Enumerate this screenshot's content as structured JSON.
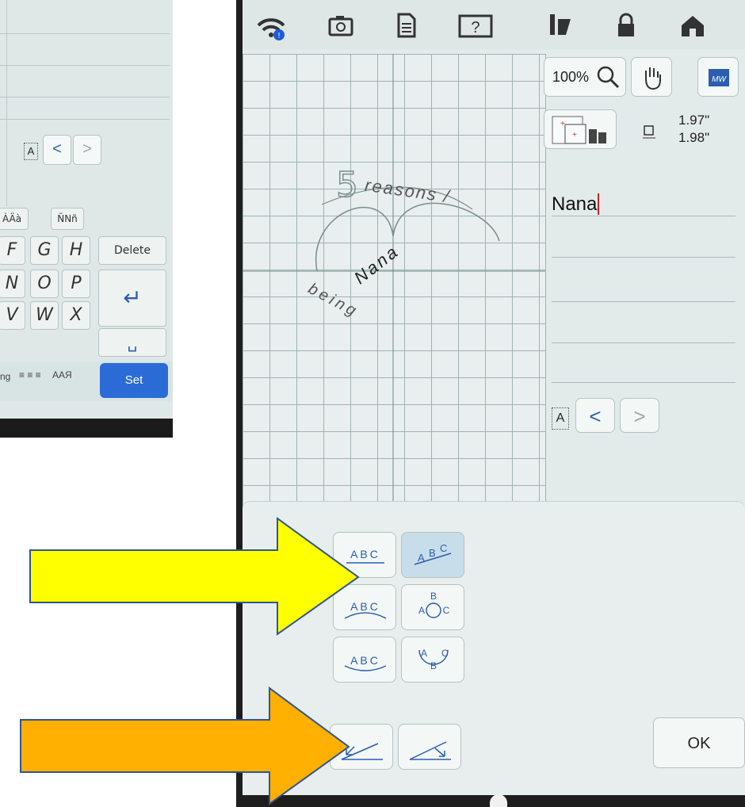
{
  "left_screen": {
    "nav_char": "A",
    "prev_label": "<",
    "next_label": ">",
    "accent_tabs": [
      "ÀÄà",
      "ÑNñ"
    ],
    "keys_row1": [
      "F",
      "G",
      "H"
    ],
    "keys_row2": [
      "N",
      "O",
      "P"
    ],
    "keys_row3": [
      "V",
      "W",
      "X"
    ],
    "delete_label": "Delete",
    "enter_icon": "↵",
    "space_icon": "␣",
    "bottom_partial": "ng",
    "align_icon": "≡ ≡ ≡",
    "font_icon": "AAЯ",
    "set_label": "Set"
  },
  "toolbar": {
    "icons": [
      "wifi-icon",
      "camera-icon",
      "document-icon",
      "help-icon",
      "needle-icon",
      "lock-icon",
      "home-icon"
    ]
  },
  "canvas": {
    "big_five": "5",
    "words": {
      "reasons": "reasons /",
      "being": "being",
      "nana": "Nana"
    }
  },
  "zoom": {
    "value": "100%"
  },
  "size": {
    "width": "1.97\"",
    "height": "1.98\""
  },
  "text_entry": {
    "value": "Nana"
  },
  "char_nav": {
    "char": "A",
    "prev": "<",
    "next": ">"
  },
  "arrangements": [
    {
      "name": "straight",
      "label": "ABC"
    },
    {
      "name": "staircase",
      "label": "ABC",
      "selected": true
    },
    {
      "name": "arc-up",
      "label": "ABC"
    },
    {
      "name": "circle",
      "label": "ABC"
    },
    {
      "name": "arc-down",
      "label": "ABC"
    },
    {
      "name": "circle-bottom",
      "label": "ABC"
    }
  ],
  "ok_label": "OK",
  "colors": {
    "yellow_arrow": "#ffff00",
    "orange_arrow": "#ffb000",
    "blue_accent": "#2b5db0",
    "set_button": "#2a6bd6"
  }
}
